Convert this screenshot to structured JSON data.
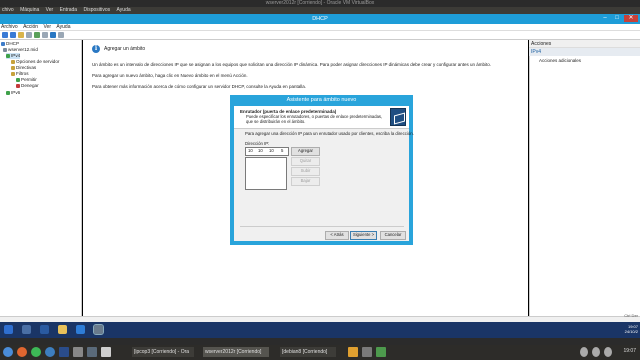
{
  "host": {
    "title": "wserver2012r [Corriendo] - Oracle VM VirtualBox",
    "menu": [
      "chivo",
      "Máquina",
      "Ver",
      "Entrada",
      "Dispositivos",
      "Ayuda"
    ],
    "taskbar": [
      {
        "label": "[ipcop3 [Corriendo] - Ora"
      },
      {
        "label": "wserver2012r [Corriendo]"
      },
      {
        "label": "[debian8 [Corriendo]"
      }
    ]
  },
  "window": {
    "title": "DHCP",
    "menu": [
      "Archivo",
      "Acción",
      "Ver",
      "Ayuda"
    ]
  },
  "tree": {
    "items": [
      {
        "label": "DHCP"
      },
      {
        "label": "wserver12.mid"
      },
      {
        "label": "IPv4"
      },
      {
        "label": "Opciones de servidor"
      },
      {
        "label": "Directivas"
      },
      {
        "label": "Filtros"
      },
      {
        "label": "Permitir"
      },
      {
        "label": "Denegar"
      },
      {
        "label": "IPv6"
      }
    ]
  },
  "content": {
    "heading": "Agregar un ámbito",
    "paragraphs": [
      "Un ámbito es un intervalo de direcciones IP que se asignan a los equipos que solicitan una dirección IP dinámica. Para poder asignar direcciones IP dinámicas debe crear y configurar antes un ámbito.",
      "Para agregar un nuevo ámbito, haga clic en Nuevo ámbito en el menú Acción.",
      "Para obtener más información acerca de cómo configurar un servidor DHCP, consulte la Ayuda en pantalla."
    ]
  },
  "actions": {
    "header": "Acciones",
    "section": "IPv4",
    "item": "Acciones adicionales"
  },
  "wizard": {
    "title": "Asistente para ámbito nuevo",
    "header_title": "Enrutador (puerta de enlace predeterminada)",
    "header_desc": "Puede especificar los enrutadores, o puertas de enlace predeterminadas, que se distribuirán en el ámbito.",
    "prompt": "Para agregar una dirección IP para un enrutador usado por clientes, escriba la dirección.",
    "ip_label": "Dirección IP:",
    "ip_segments": [
      "10",
      "10",
      "10",
      "5"
    ],
    "buttons": {
      "add": "Agregar",
      "remove": "Quitar",
      "up": "Subir",
      "down": "Bajar",
      "back": "< Atrás",
      "next": "Siguiente >",
      "cancel": "Cancelar"
    }
  },
  "guest_clock": {
    "time": "19:07",
    "date": "24/10/2"
  },
  "corner_text": "Ctrl Der",
  "host_clock": "19:07"
}
